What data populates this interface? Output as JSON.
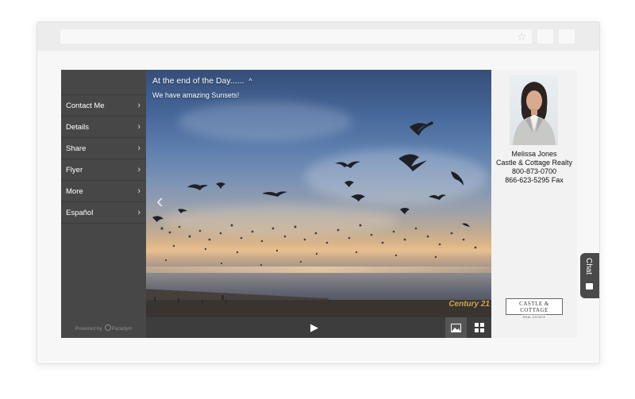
{
  "menu": {
    "items": [
      {
        "label": "Contact Me"
      },
      {
        "label": "Details"
      },
      {
        "label": "Share"
      },
      {
        "label": "Flyer"
      },
      {
        "label": "More"
      },
      {
        "label": "Español"
      }
    ],
    "powered_by": "Powered by",
    "powered_brand": "Paradym"
  },
  "slide": {
    "title": "At the end of the Day......",
    "caption": "We have amazing Sunsets!",
    "watermark": "Century 21"
  },
  "controls": {
    "play_icon": "play-icon",
    "photo_view_icon": "image-icon",
    "grid_view_icon": "grid-icon"
  },
  "agent": {
    "name": "Melissa Jones",
    "company": "Castle & Cottage Realty",
    "phone": "800-873-0700",
    "fax": "866-623-5295 Fax"
  },
  "brand_logo": {
    "name": "CASTLE & COTTAGE",
    "tagline": "REAL ESTATE"
  },
  "chat": {
    "label": "Chat"
  },
  "colors": {
    "sidebar": "#474747",
    "control_bar": "#3d3d3d",
    "panel": "#f2f2f2"
  }
}
